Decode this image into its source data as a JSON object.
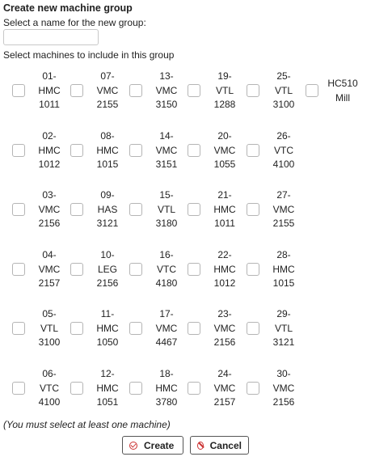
{
  "form": {
    "title": "Create new machine group",
    "name_prompt": "Select a name for the new group:",
    "name_value": "",
    "select_label": "Select machines to include in this group",
    "note": "(You must select at least one machine)",
    "create_label": "Create",
    "cancel_label": "Cancel"
  },
  "machines": [
    [
      {
        "line1": "01-",
        "line2": "HMC",
        "line3": "1011",
        "checked": false
      },
      {
        "line1": "07-",
        "line2": "VMC",
        "line3": "2155",
        "checked": false
      },
      {
        "line1": "13-",
        "line2": "VMC",
        "line3": "3150",
        "checked": false
      },
      {
        "line1": "19-",
        "line2": "VTL",
        "line3": "1288",
        "checked": false
      },
      {
        "line1": "25-",
        "line2": "VTL",
        "line3": "3100",
        "checked": false
      },
      {
        "line1": "",
        "line2": "HC510",
        "line3": "Mill",
        "checked": false
      }
    ],
    [
      {
        "line1": "02-",
        "line2": "HMC",
        "line3": "1012",
        "checked": false
      },
      {
        "line1": "08-",
        "line2": "HMC",
        "line3": "1015",
        "checked": false
      },
      {
        "line1": "14-",
        "line2": "VMC",
        "line3": "3151",
        "checked": false
      },
      {
        "line1": "20-",
        "line2": "VMC",
        "line3": "1055",
        "checked": false
      },
      {
        "line1": "26-",
        "line2": "VTC",
        "line3": "4100",
        "checked": false
      }
    ],
    [
      {
        "line1": "03-",
        "line2": "VMC",
        "line3": "2156",
        "checked": false
      },
      {
        "line1": "09-",
        "line2": "HAS",
        "line3": "3121",
        "checked": false
      },
      {
        "line1": "15-",
        "line2": "VTL",
        "line3": "3180",
        "checked": false
      },
      {
        "line1": "21-",
        "line2": "HMC",
        "line3": "1011",
        "checked": false
      },
      {
        "line1": "27-",
        "line2": "VMC",
        "line3": "2155",
        "checked": false
      }
    ],
    [
      {
        "line1": "04-",
        "line2": "VMC",
        "line3": "2157",
        "checked": false
      },
      {
        "line1": "10-",
        "line2": "LEG",
        "line3": "2156",
        "checked": false
      },
      {
        "line1": "16-",
        "line2": "VTC",
        "line3": "4180",
        "checked": false
      },
      {
        "line1": "22-",
        "line2": "HMC",
        "line3": "1012",
        "checked": false
      },
      {
        "line1": "28-",
        "line2": "HMC",
        "line3": "1015",
        "checked": false
      }
    ],
    [
      {
        "line1": "05-",
        "line2": "VTL",
        "line3": "3100",
        "checked": false
      },
      {
        "line1": "11-",
        "line2": "HMC",
        "line3": "1050",
        "checked": false
      },
      {
        "line1": "17-",
        "line2": "VMC",
        "line3": "4467",
        "checked": false
      },
      {
        "line1": "23-",
        "line2": "VMC",
        "line3": "2156",
        "checked": false
      },
      {
        "line1": "29-",
        "line2": "VTL",
        "line3": "3121",
        "checked": false
      }
    ],
    [
      {
        "line1": "06-",
        "line2": "VTC",
        "line3": "4100",
        "checked": false
      },
      {
        "line1": "12-",
        "line2": "HMC",
        "line3": "1051",
        "checked": false
      },
      {
        "line1": "18-",
        "line2": "HMC",
        "line3": "3780",
        "checked": false
      },
      {
        "line1": "24-",
        "line2": "VMC",
        "line3": "2157",
        "checked": false
      },
      {
        "line1": "30-",
        "line2": "VMC",
        "line3": "2156",
        "checked": false
      }
    ]
  ]
}
